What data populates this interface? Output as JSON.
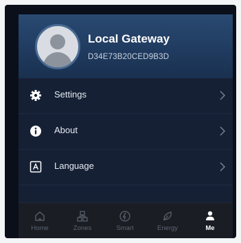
{
  "header": {
    "name": "Local Gateway",
    "device_id": "D34E73B20CED9B3D"
  },
  "menu": {
    "items": [
      {
        "label": "Settings",
        "icon": "gear-icon"
      },
      {
        "label": "About",
        "icon": "info-icon"
      },
      {
        "label": "Language",
        "icon": "language-icon"
      }
    ]
  },
  "tabbar": {
    "tabs": [
      {
        "label": "Home",
        "icon": "home-icon",
        "active": false
      },
      {
        "label": "Zones",
        "icon": "zones-icon",
        "active": false
      },
      {
        "label": "Smart",
        "icon": "smart-icon",
        "active": false
      },
      {
        "label": "Energy",
        "icon": "leaf-icon",
        "active": false
      },
      {
        "label": "Me",
        "icon": "person-icon",
        "active": true
      }
    ]
  },
  "colors": {
    "header_bg": "#2a4a72",
    "menu_bg": "#162035",
    "tabbar_bg": "#1a1d24",
    "inactive_tab": "#5c6470",
    "active_tab": "#ffffff"
  }
}
